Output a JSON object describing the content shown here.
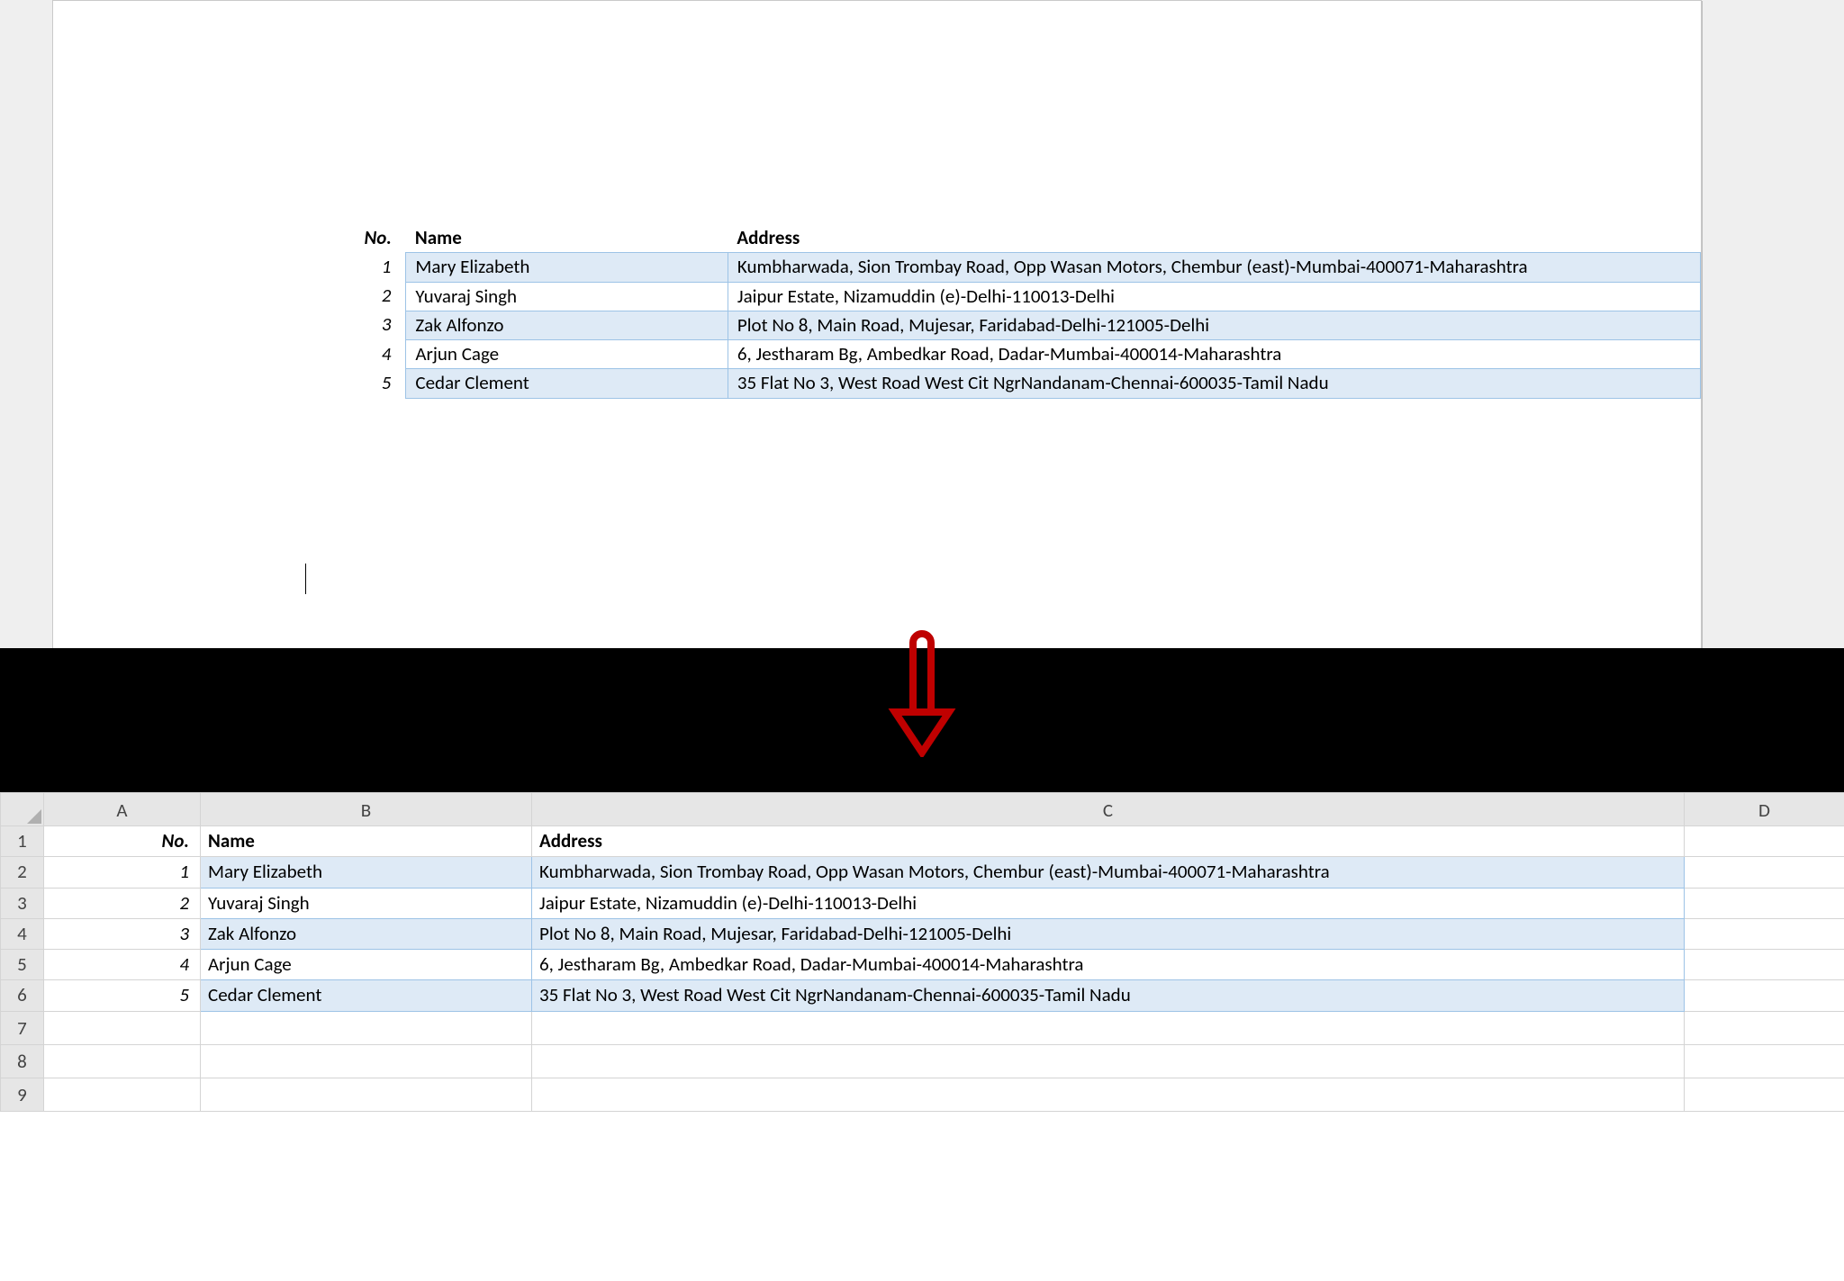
{
  "word_table": {
    "headers": {
      "no": "No.",
      "name": "Name",
      "address": "Address"
    },
    "rows": [
      {
        "no": "1",
        "name": "Mary Elizabeth",
        "address": "Kumbharwada, Sion Trombay Road, Opp Wasan Motors, Chembur (east)-Mumbai-400071-Maharashtra"
      },
      {
        "no": "2",
        "name": "Yuvaraj Singh",
        "address": "Jaipur Estate, Nizamuddin (e)-Delhi-110013-Delhi"
      },
      {
        "no": "3",
        "name": "Zak Alfonzo",
        "address": "Plot No 8, Main Road, Mujesar, Faridabad-Delhi-121005-Delhi"
      },
      {
        "no": "4",
        "name": "Arjun Cage",
        "address": "6, Jestharam Bg, Ambedkar Road, Dadar-Mumbai-400014-Maharashtra"
      },
      {
        "no": "5",
        "name": "Cedar Clement",
        "address": "35 Flat No 3, West Road West Cit NgrNandanam-Chennai-600035-Tamil Nadu"
      }
    ]
  },
  "excel": {
    "col_headers": [
      "A",
      "B",
      "C",
      "D"
    ],
    "row_numbers": [
      "1",
      "2",
      "3",
      "4",
      "5",
      "6",
      "7",
      "8",
      "9"
    ],
    "header_row": {
      "no": "No.",
      "name": "Name",
      "address": "Address"
    },
    "rows": [
      {
        "no": "1",
        "name": "Mary Elizabeth",
        "address": "Kumbharwada, Sion Trombay Road, Opp Wasan Motors, Chembur (east)-Mumbai-400071-Maharashtra"
      },
      {
        "no": "2",
        "name": "Yuvaraj Singh",
        "address": "Jaipur Estate, Nizamuddin (e)-Delhi-110013-Delhi"
      },
      {
        "no": "3",
        "name": "Zak Alfonzo",
        "address": "Plot No 8, Main Road, Mujesar, Faridabad-Delhi-121005-Delhi"
      },
      {
        "no": "4",
        "name": "Arjun Cage",
        "address": "6, Jestharam Bg, Ambedkar Road, Dadar-Mumbai-400014-Maharashtra"
      },
      {
        "no": "5",
        "name": "Cedar Clement",
        "address": "35 Flat No 3, West Road West Cit NgrNandanam-Chennai-600035-Tamil Nadu"
      }
    ]
  }
}
